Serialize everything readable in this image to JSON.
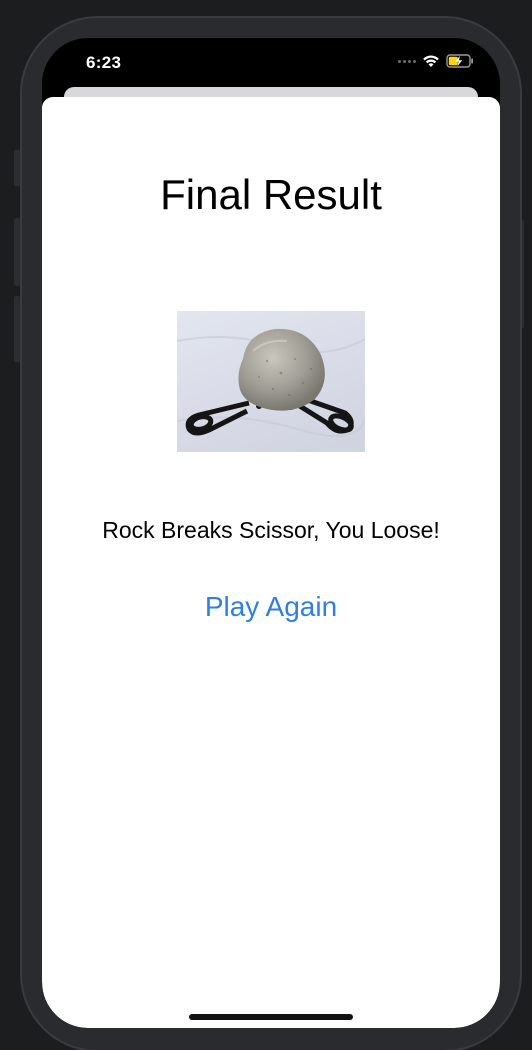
{
  "status_bar": {
    "time": "6:23",
    "icons": [
      "signal-dots-icon",
      "wifi-icon",
      "battery-charging-icon"
    ]
  },
  "screen": {
    "title": "Final Result",
    "result_image": {
      "depicts": "rock-on-scissors-image"
    },
    "message": "Rock Breaks Scissor, You Loose!",
    "play_again_label": "Play Again"
  },
  "colors": {
    "accent": "#2f7fe0",
    "sheet_background": "#ffffff",
    "device_background": "#1c1d1f"
  }
}
